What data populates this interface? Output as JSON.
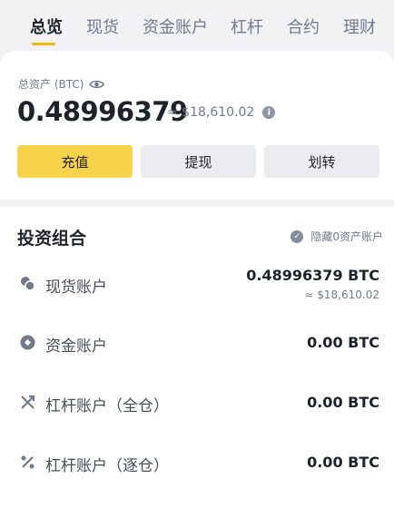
{
  "tabs": [
    {
      "label": "总览",
      "active": true
    },
    {
      "label": "现货"
    },
    {
      "label": "资金账户"
    },
    {
      "label": "杠杆"
    },
    {
      "label": "合约"
    },
    {
      "label": "理财"
    }
  ],
  "overview": {
    "asset_label": "总资产 (BTC)",
    "total_btc": "0.48996379",
    "total_usd": "≈ $18,610.02",
    "info_glyph": "i"
  },
  "actions": {
    "deposit": "充值",
    "withdraw": "提现",
    "transfer": "划转"
  },
  "portfolio": {
    "title": "投资组合",
    "hide_zero_label": "隐藏0资产账户",
    "hide_zero_checked": true,
    "accounts": [
      {
        "name": "现货账户",
        "value": "0.48996379 BTC",
        "sub": "≈ $18,610.02",
        "icon": "spot-icon"
      },
      {
        "name": "资金账户",
        "value": "0.00 BTC",
        "icon": "funding-icon"
      },
      {
        "name": "杠杆账户（全仓）",
        "value": "0.00 BTC",
        "icon": "cross-margin-icon"
      },
      {
        "name": "杠杆账户（逐仓）",
        "value": "0.00 BTC",
        "icon": "isolated-margin-icon"
      }
    ]
  },
  "colors": {
    "accent": "#f0b90b",
    "deposit_button": "#f7d24b",
    "secondary_button": "#eaecef",
    "text_primary": "#1e2329",
    "text_secondary": "#707a8a"
  }
}
